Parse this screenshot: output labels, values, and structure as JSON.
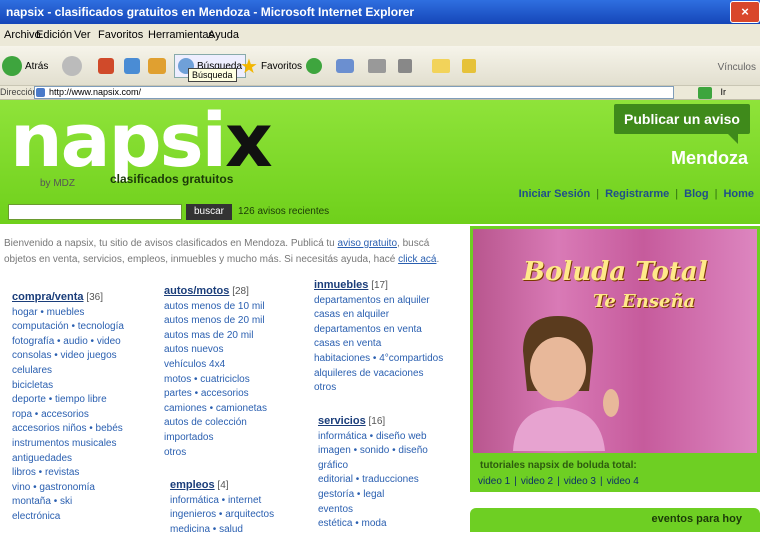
{
  "window": {
    "title": "napsix - clasificados gratuitos en Mendoza - Microsoft Internet Explorer",
    "close": "×"
  },
  "menu": [
    "Archivo",
    "Edición",
    "Ver",
    "Favoritos",
    "Herramientas",
    "Ayuda"
  ],
  "toolbar": {
    "back": "Atrás",
    "search": "Búsqueda",
    "search_tooltip": "Búsqueda",
    "favorites": "Favoritos",
    "links": "Vínculos"
  },
  "address": {
    "label": "Dirección",
    "url": "http://www.napsix.com/",
    "go": "Ir"
  },
  "header": {
    "logo_main": "napsi",
    "logo_x": "x",
    "by": "by MDZ",
    "tagline": "clasificados gratuitos",
    "publish_button": "Publicar un aviso",
    "city": "Mendoza",
    "search_button": "buscar",
    "recent": "126 avisos recientes",
    "nav": [
      "Iniciar Sesión",
      "Registrarme",
      "Blog",
      "Home"
    ]
  },
  "intro": {
    "text1": "Bienvenido a napsix, tu sitio de avisos clasificados en Mendoza. Publicá tu ",
    "link1": "aviso gratuito",
    "text2": ", buscá objetos en venta, servicios, empleos, inmuebles y mucho más. Si necesitás ayuda, hacé ",
    "link2": "click acá",
    "text3": "."
  },
  "categories": {
    "compra": {
      "title": "compra/venta",
      "count": "[36]",
      "items": [
        "hogar • muebles",
        "computación • tecnología",
        "fotografía • audio • video",
        "consolas • video juegos",
        "celulares",
        "bicicletas",
        "deporte • tiempo libre",
        "ropa • accesorios",
        "accesorios niños • bebés",
        "instrumentos musicales",
        "antiguedades",
        "libros • revistas",
        "vino • gastronomía",
        "montaña • ski",
        "electrónica"
      ]
    },
    "autos": {
      "title": "autos/motos",
      "count": "[28]",
      "items": [
        "autos menos de 10 mil",
        "autos menos de 20 mil",
        "autos mas de 20 mil",
        "autos nuevos",
        "vehículos 4x4",
        "motos • cuatriciclos",
        "partes • accesorios",
        "camiones • camionetas",
        "autos de colección",
        "importados",
        "otros"
      ]
    },
    "empleos": {
      "title": "empleos",
      "count": "[4]",
      "items": [
        "informática • internet",
        "ingenieros • arquitectos",
        "medicina • salud"
      ]
    },
    "inmuebles": {
      "title": "inmuebles",
      "count": "[17]",
      "items": [
        "departamentos en alquiler",
        "casas en alquiler",
        "departamentos en venta",
        "casas en venta",
        "habitaciones • 4°compartidos",
        "alquileres de vacaciones",
        "otros"
      ]
    },
    "servicios": {
      "title": "servicios",
      "count": "[16]",
      "items": [
        "informática • diseño web",
        "imagen • sonido • diseño",
        "gráfico",
        "editorial • traducciones",
        "gestoría • legal",
        "eventos",
        "estética • moda"
      ]
    }
  },
  "promo": {
    "title1": "Boluda Total",
    "title2": "Te Enseña",
    "caption": "tutoriales napsix de boluda total:",
    "videos": [
      "video 1",
      "video 2",
      "video 3",
      "video 4"
    ]
  },
  "events": {
    "label": "eventos para hoy"
  },
  "colors": {
    "brand_green": "#7ad82a",
    "dark_green": "#3f8a1b",
    "link_blue": "#2a5fb0"
  }
}
